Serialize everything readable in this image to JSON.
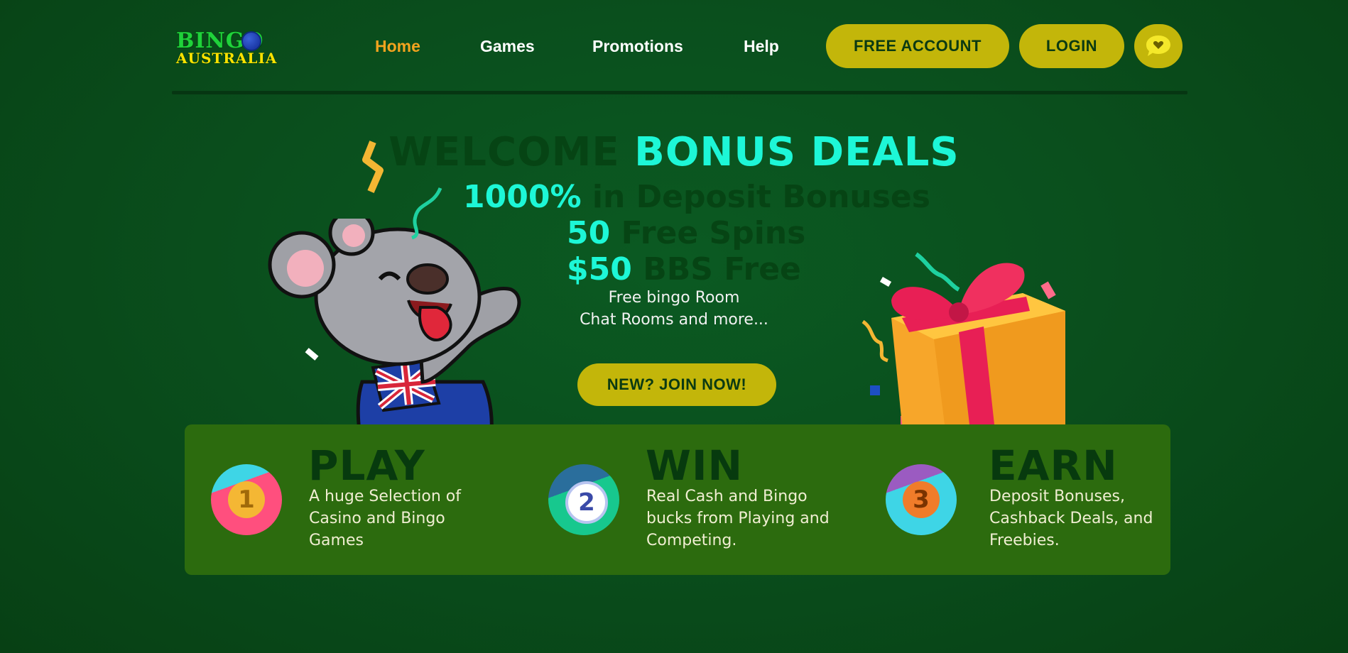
{
  "brand": {
    "logo_line1": "BINGO",
    "logo_line2": "AUSTRALIA"
  },
  "nav": {
    "items": [
      {
        "label": "Home",
        "active": true
      },
      {
        "label": "Games",
        "active": false
      },
      {
        "label": "Promotions",
        "active": false
      },
      {
        "label": "Help",
        "active": false
      }
    ],
    "free_account_label": "FREE ACCOUNT",
    "login_label": "LOGIN",
    "chat_icon": "chat-heart-icon"
  },
  "hero": {
    "title_dark": "WELCOME",
    "title_highlight": "BONUS DEALS",
    "deal1_value": "1000%",
    "deal1_text": "in Deposit Bonuses",
    "deal2_value": "50",
    "deal2_text": "Free Spins",
    "deal3_value": "$50",
    "deal3_text": "BBS Free",
    "extra_line1": "Free bingo Room",
    "extra_line2": "Chat Rooms and more...",
    "cta_label": "NEW? JOIN NOW!"
  },
  "features": [
    {
      "number": "1",
      "title": "PLAY",
      "description": "A huge Selection of Casino and Bingo Games"
    },
    {
      "number": "2",
      "title": "WIN",
      "description": "Real Cash and Bingo bucks from Playing and Competing."
    },
    {
      "number": "3",
      "title": "EARN",
      "description": "Deposit Bonuses, Cashback Deals, and Freebies."
    }
  ],
  "colors": {
    "accent_yellow": "#c3b60a",
    "highlight_cyan": "#1df7d7",
    "active_nav": "#f3a31e",
    "panel_green": "#2c6b0e"
  }
}
